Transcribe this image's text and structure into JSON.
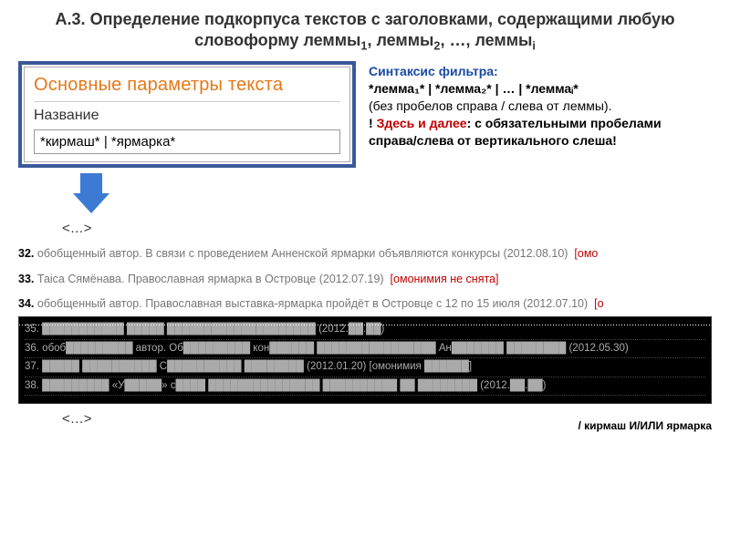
{
  "title": {
    "prefix": "А.3.",
    "line1": "Определение подкорпуса текстов с заголовками, содержащими",
    "strong": "любую словоформу леммы",
    "sub1": "1",
    "mid": ", леммы",
    "sub2": "2",
    "tail": ", …, леммы",
    "subi": "i"
  },
  "panel": {
    "heading": "Основные параметры текста",
    "label": "Название",
    "value": "*кирмаш* | *ярмарка*"
  },
  "syntax": {
    "head": "Синтаксис фильтра:",
    "pattern": "*лемма₁* | *лемма₂* | … | *леммаᵢ*",
    "note1": "(без пробелов справа / слева от леммы).",
    "bang": "!",
    "red": "Здесь и далее",
    "bold": ": с обязательными пробелами справа/слева от вертикального слеша!"
  },
  "ellipsis": "<…>",
  "results": [
    {
      "num": "32.",
      "text": "обобщенный автор. В связи с проведением Анненской ярмарки объявляются конкурсы (2012.08.10)",
      "omon": "[омо"
    },
    {
      "num": "33.",
      "text": "Таіса Сямёнава. Православная ярмарка в Островце (2012.07.19)",
      "omon": "[омонимия не снята]"
    },
    {
      "num": "34.",
      "text": "обобщенный автор. Православная выставка-ярмарка пройдёт в Островце с 12 по 15 июля (2012.07.10)",
      "omon": "[о"
    }
  ],
  "dark": [
    "35. ███████████ █████ ████████████████████ (2012.██.██)",
    "36. обоб█████████ автор. Об█████████ кон██████ ████████████████ Ан███████ ████████ (2012.05.30)",
    "37. █████ ██████████ С██████████ ████████ (2012.01.20)  [омонимия ██████]",
    "38. █████████ «У█████» с████ ███████████████ ██████████ ██ ████████ (2012.██.██)"
  ],
  "footer": "/ кирмаш И/ИЛИ ярмарка"
}
